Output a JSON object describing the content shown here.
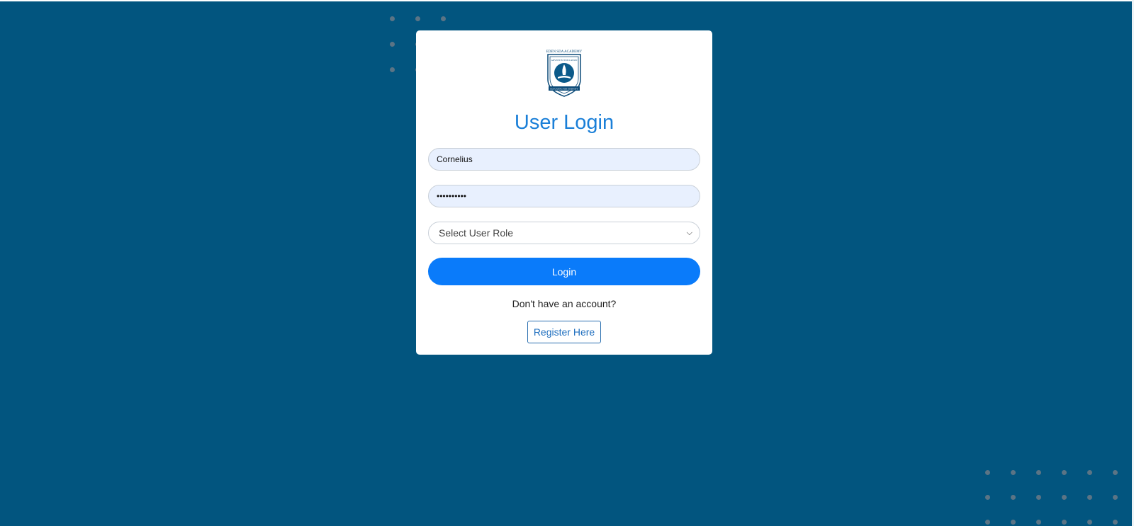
{
  "page": {
    "background_color": "#02557f",
    "accent_color": "#0a7bfa",
    "title_color": "#1a7fd8"
  },
  "login_card": {
    "logo_icon": "eden-sda-academy-crest",
    "logo_text_top": "EDEN SDA ACADEMY",
    "title": "User Login",
    "username_value": "Cornelius",
    "password_value": "••••••••••",
    "role_select_value": "Select User Role",
    "login_label": "Login",
    "no_account_text": "Don't have an account?",
    "register_label": "Register Here"
  }
}
